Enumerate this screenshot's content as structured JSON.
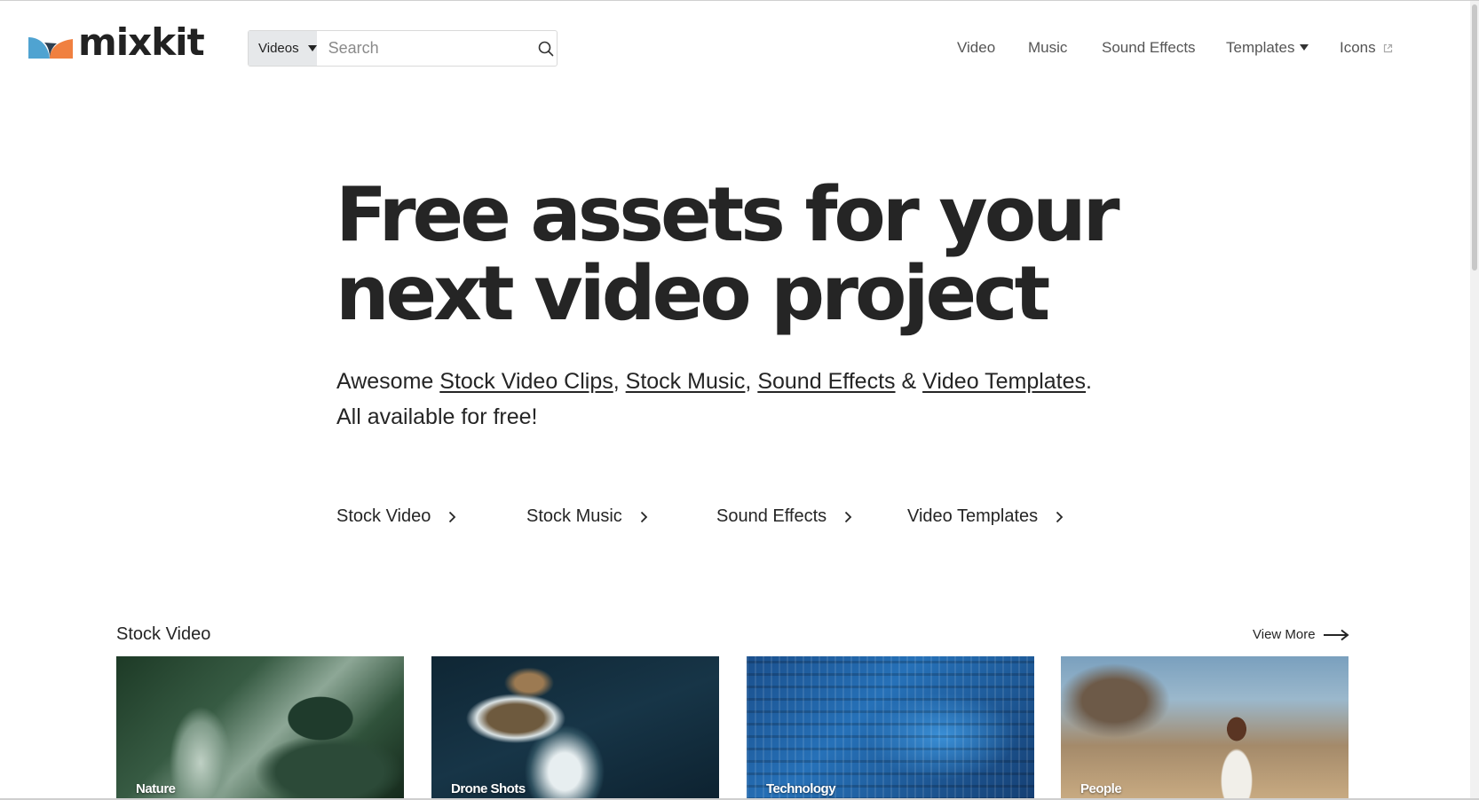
{
  "brand": {
    "name": "mixkit",
    "colors": {
      "blue": "#4fa3d1",
      "orange": "#f08040",
      "dark": "#252525"
    }
  },
  "search": {
    "category": "Videos",
    "placeholder": "Search"
  },
  "nav": {
    "video": "Video",
    "music": "Music",
    "sound_effects": "Sound Effects",
    "templates": "Templates",
    "icons": "Icons"
  },
  "hero": {
    "title_line1": "Free assets for your",
    "title_line2": "next video project",
    "sub_prefix": "Awesome ",
    "link_stock_video_clips": "Stock Video Clips",
    "sep1": ", ",
    "link_stock_music": "Stock Music",
    "sep2": ", ",
    "link_sound_effects": "Sound Effects",
    "sep3": " & ",
    "link_video_templates": "Video Templates",
    "sub_suffix": ".",
    "line2": "All available for free!"
  },
  "categories": [
    {
      "label": "Stock Video"
    },
    {
      "label": "Stock Music"
    },
    {
      "label": "Sound Effects"
    },
    {
      "label": "Video Templates"
    }
  ],
  "stock_video": {
    "title": "Stock Video",
    "view_more": "View More",
    "items": [
      {
        "label": "Nature"
      },
      {
        "label": "Drone Shots"
      },
      {
        "label": "Technology"
      },
      {
        "label": "People"
      }
    ]
  }
}
